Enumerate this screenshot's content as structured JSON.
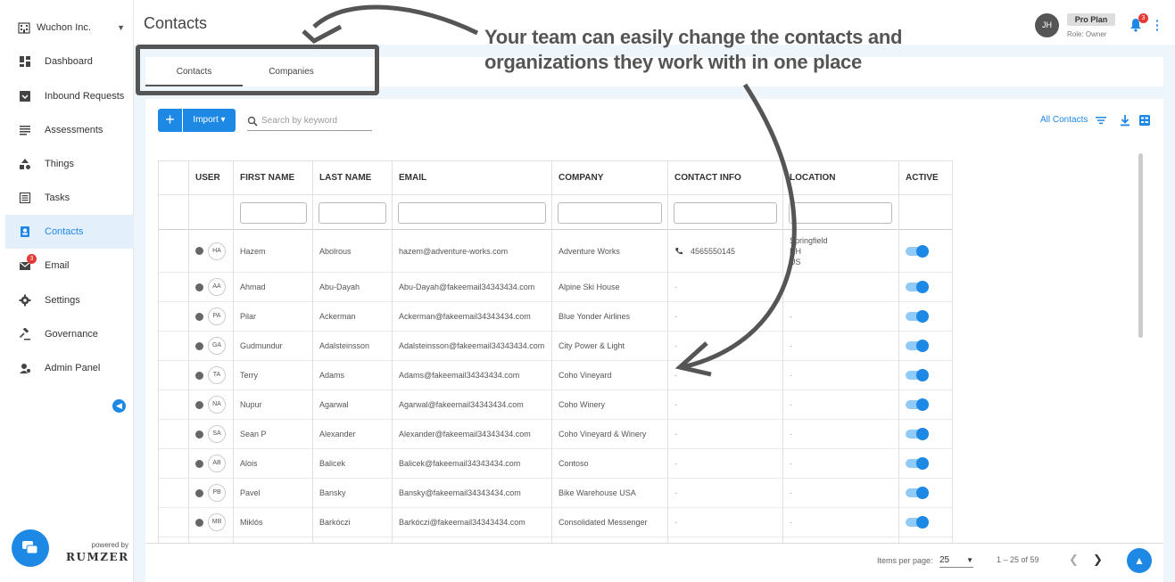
{
  "org": {
    "name": "Wuchon Inc."
  },
  "sidebar": {
    "items": [
      {
        "label": "Dashboard",
        "icon": "dashboard-icon"
      },
      {
        "label": "Inbound Requests",
        "icon": "inbox-icon"
      },
      {
        "label": "Assessments",
        "icon": "list-icon"
      },
      {
        "label": "Things",
        "icon": "shapes-icon"
      },
      {
        "label": "Tasks",
        "icon": "tasks-icon"
      },
      {
        "label": "Contacts",
        "icon": "contacts-icon",
        "active": true
      },
      {
        "label": "Email",
        "icon": "mail-icon",
        "badge": "3"
      },
      {
        "label": "Settings",
        "icon": "gear-icon"
      },
      {
        "label": "Governance",
        "icon": "gavel-icon"
      },
      {
        "label": "Admin Panel",
        "icon": "admin-icon"
      }
    ],
    "powered_by": "powered by",
    "brand": "RUMZER"
  },
  "header": {
    "title": "Contacts",
    "user_initials": "JH",
    "plan": "Pro Plan",
    "role": "Role: Owner",
    "notifications": "3"
  },
  "tabs": [
    {
      "label": "Contacts",
      "active": true
    },
    {
      "label": "Companies",
      "active": false
    }
  ],
  "toolbar": {
    "add_label": "+",
    "import_label": "Import",
    "search_placeholder": "Search by keyword",
    "view_label": "All Contacts"
  },
  "table": {
    "columns": [
      "USER",
      "FIRST NAME",
      "LAST NAME",
      "EMAIL",
      "COMPANY",
      "CONTACT INFO",
      "LOCATION",
      "ACTIVE"
    ],
    "rows": [
      {
        "initials": "HA",
        "first": "Hazem",
        "last": "Abolrous",
        "email": "hazem@adventure-works.com",
        "company": "Adventure Works",
        "contact": "4565550145",
        "location": [
          "Springfield",
          "NH",
          "US"
        ],
        "active": true
      },
      {
        "initials": "AA",
        "first": "Ahmad",
        "last": "Abu-Dayah",
        "email": "Abu-Dayah@fakeemail34343434.com",
        "company": "Alpine Ski House",
        "contact": "-",
        "location": [],
        "active": true
      },
      {
        "initials": "PA",
        "first": "Pilar",
        "last": "Ackerman",
        "email": "Ackerman@fakeemail34343434.com",
        "company": "Blue Yonder Airlines",
        "contact": "-",
        "location": [
          "-"
        ],
        "active": true
      },
      {
        "initials": "GA",
        "first": "Gudmundur",
        "last": "Adalsteinsson",
        "email": "Adalsteinsson@fakeemail34343434.com",
        "company": "City Power & Light",
        "contact": "-",
        "location": [
          "-"
        ],
        "active": true
      },
      {
        "initials": "TA",
        "first": "Terry",
        "last": "Adams",
        "email": "Adams@fakeemail34343434.com",
        "company": "Coho Vineyard",
        "contact": "-",
        "location": [
          "-"
        ],
        "active": true
      },
      {
        "initials": "NA",
        "first": "Nupur",
        "last": "Agarwal",
        "email": "Agarwal@fakeemail34343434.com",
        "company": "Coho Winery",
        "contact": "-",
        "location": [
          "-"
        ],
        "active": true
      },
      {
        "initials": "SA",
        "first": "Sean P",
        "last": "Alexander",
        "email": "Alexander@fakeemail34343434.com",
        "company": "Coho Vineyard & Winery",
        "contact": "-",
        "location": [
          "-"
        ],
        "active": true
      },
      {
        "initials": "AB",
        "first": "Alois",
        "last": "Balicek",
        "email": "Balicek@fakeemail34343434.com",
        "company": "Contoso",
        "contact": "-",
        "location": [
          "-"
        ],
        "active": true
      },
      {
        "initials": "PB",
        "first": "Pavel",
        "last": "Bansky",
        "email": "Bansky@fakeemail34343434.com",
        "company": "Bike Warehouse USA",
        "contact": "-",
        "location": [
          "-"
        ],
        "active": true
      },
      {
        "initials": "MB",
        "first": "Miklós",
        "last": "Barkóczi",
        "email": "Barkóczi@fakeemail34343434.com",
        "company": "Consolidated Messenger",
        "contact": "-",
        "location": [
          "-"
        ],
        "active": true
      }
    ]
  },
  "pagination": {
    "items_per_page_label": "Items per page:",
    "items_per_page": "25",
    "range": "1 – 25 of 59"
  },
  "annotation": {
    "line1": "Your team can easily change the contacts and",
    "line2": "organizations they work with in one place"
  },
  "colors": {
    "accent": "#1e88e5",
    "annotation": "#555555",
    "badge": "#e53935"
  }
}
